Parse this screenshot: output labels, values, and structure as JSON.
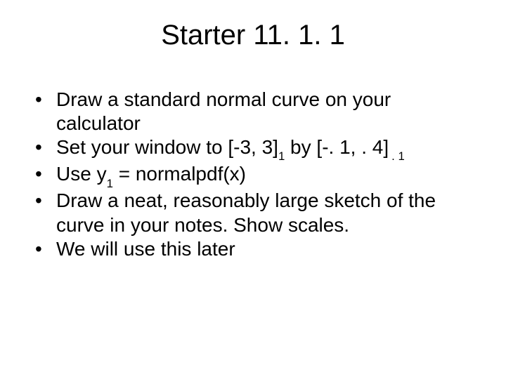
{
  "title": "Starter 11. 1. 1",
  "bullets": {
    "b0": "Draw a standard normal curve on your calculator",
    "b1_a": "Set your window to [-3, 3]",
    "b1_b": "1",
    "b1_c": " by [-. 1, . 4]",
    "b1_d": ". 1",
    "b2_a": "Use y",
    "b2_b": "1",
    "b2_c": " = normalpdf(x)",
    "b3": "Draw a neat, reasonably large sketch of the curve in your notes.  Show scales.",
    "b4": "We will use this later"
  }
}
